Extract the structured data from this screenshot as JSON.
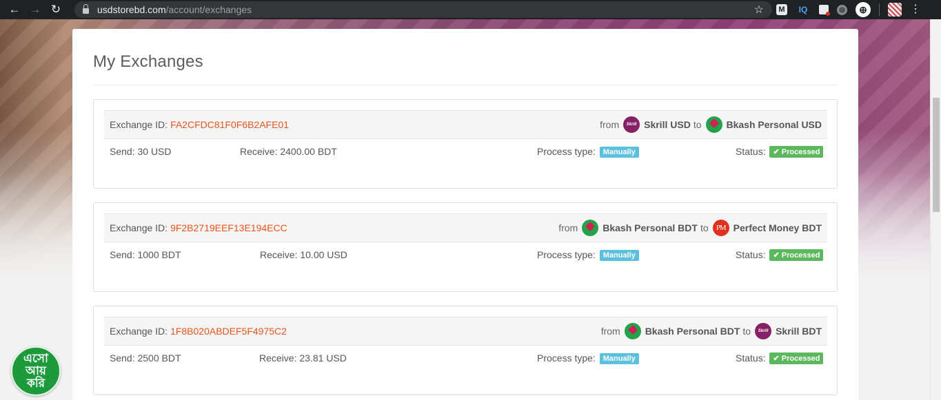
{
  "browser": {
    "url_host": "usdstorebd.com",
    "url_path": "/account/exchanges",
    "back_glyph": "←",
    "forward_glyph": "→",
    "reload_glyph": "↻",
    "star_glyph": "☆",
    "menu_glyph": "⋮",
    "extensions": [
      {
        "icon": "m-icon",
        "label": "M"
      },
      {
        "icon": "iq-icon",
        "label": "IQ"
      },
      {
        "icon": "chart-extension-icon",
        "label": ""
      },
      {
        "icon": "circle-extension-icon",
        "label": ""
      },
      {
        "icon": "target-extension-icon",
        "label": "⊕"
      },
      {
        "icon": "profile-avatar",
        "label": ""
      }
    ]
  },
  "page": {
    "title": "My Exchanges"
  },
  "labels": {
    "exchange_id": "Exchange ID:",
    "from": "from",
    "to": "to",
    "process_type": "Process type:",
    "status": "Status:"
  },
  "exchanges": [
    {
      "id": "FA2CFDC81F0F6B2AFE01",
      "from_service": "Skrill USD",
      "from_logo": "skrill-logo",
      "to_service": "Bkash Personal USD",
      "to_logo": "bkash-logo",
      "send": "Send: 30 USD",
      "receive": "Receive: 2400.00 BDT",
      "process_type": "Manually",
      "status": "Processed"
    },
    {
      "id": "9F2B2719EEF13E194ECC",
      "from_service": "Bkash Personal BDT",
      "from_logo": "bkash-logo",
      "to_service": "Perfect Money BDT",
      "to_logo": "perfect-money-logo",
      "send": "Send: 1000 BDT",
      "receive": "Receive: 10.00 USD",
      "process_type": "Manually",
      "status": "Processed"
    },
    {
      "id": "1F8B020ABDEF5F4975C2",
      "from_service": "Bkash Personal BDT",
      "from_logo": "bkash-logo",
      "to_service": "Skrill BDT",
      "to_logo": "skrill-logo",
      "send": "Send: 2500 BDT",
      "receive": "Receive: 23.81 USD",
      "process_type": "Manually",
      "status": "Processed"
    }
  ],
  "logos": {
    "skrill": "Skrill",
    "bkash": "",
    "perfect_money": "PM"
  },
  "status_check_glyph": "✔",
  "chat_badge": {
    "line1": "এসো",
    "line2": "আয়",
    "line3": "করি"
  },
  "colors": {
    "exchange_id": "#e8541c",
    "badge_manual": "#5bc0de",
    "badge_processed": "#5cb85c",
    "skrill": "#862165",
    "bkash": "#23a349",
    "perfect_money": "#e0301e",
    "chat_badge": "#1d9b3c"
  }
}
